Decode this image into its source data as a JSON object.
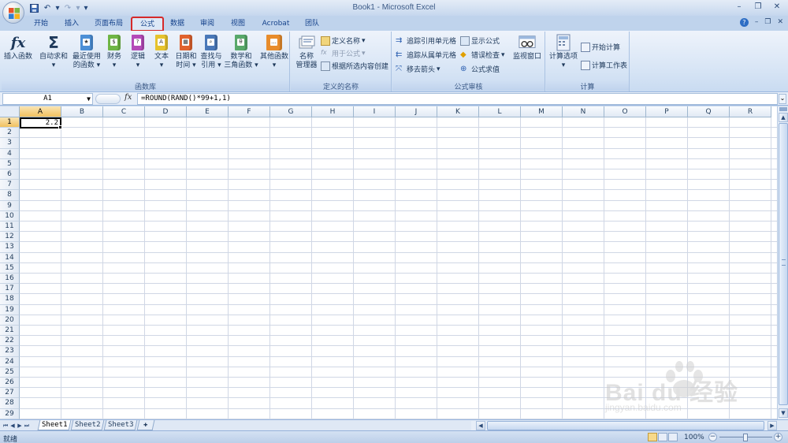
{
  "window": {
    "title": "Book1 - Microsoft Excel"
  },
  "quick_access": {
    "save_icon": "save-icon",
    "undo_icon": "undo-icon",
    "redo_icon": "redo-icon"
  },
  "tabs": [
    {
      "label": "开始"
    },
    {
      "label": "插入"
    },
    {
      "label": "页面布局"
    },
    {
      "label": "公式"
    },
    {
      "label": "数据"
    },
    {
      "label": "审阅"
    },
    {
      "label": "视图"
    },
    {
      "label": "Acrobat"
    },
    {
      "label": "团队"
    }
  ],
  "active_tab": "公式",
  "ribbon": {
    "function_library": {
      "label": "函数库",
      "insert_function": "插入函数",
      "autosum": "自动求和",
      "recent_line1": "最近使用",
      "recent_line2": "的函数",
      "financial": "财务",
      "logical": "逻辑",
      "text": "文本",
      "datetime_line1": "日期和",
      "datetime_line2": "时间",
      "lookup_line1": "查找与",
      "lookup_line2": "引用",
      "math_line1": "数学和",
      "math_line2": "三角函数",
      "more": "其他函数"
    },
    "defined_names": {
      "label": "定义的名称",
      "name_manager_line1": "名称",
      "name_manager_line2": "管理器",
      "define_name": "定义名称",
      "use_in_formula": "用于公式",
      "create_from_selection": "根据所选内容创建"
    },
    "formula_auditing": {
      "label": "公式审核",
      "trace_precedents": "追踪引用单元格",
      "trace_dependents": "追踪从属单元格",
      "remove_arrows": "移去箭头",
      "show_formulas": "显示公式",
      "error_checking": "错误检查",
      "evaluate_formula": "公式求值",
      "watch_window": "监视窗口"
    },
    "calculation": {
      "label": "计算",
      "options": "计算选项",
      "calc_now": "开始计算",
      "calc_sheet": "计算工作表"
    }
  },
  "formula_bar": {
    "name_box": "A1",
    "formula": "=ROUND(RAND()*99+1,1)"
  },
  "grid": {
    "columns": [
      "A",
      "B",
      "C",
      "D",
      "E",
      "F",
      "G",
      "H",
      "I",
      "J",
      "K",
      "L",
      "M",
      "N",
      "O",
      "P",
      "Q",
      "R"
    ],
    "rows": [
      "1",
      "2",
      "3",
      "4",
      "5",
      "6",
      "7",
      "8",
      "9",
      "10",
      "11",
      "12",
      "13",
      "14",
      "15",
      "16",
      "17",
      "18",
      "19",
      "20",
      "21",
      "22",
      "23",
      "24",
      "25",
      "26",
      "27",
      "28",
      "29"
    ],
    "active_cell_value": "2.2"
  },
  "sheets": [
    {
      "label": "Sheet1"
    },
    {
      "label": "Sheet2"
    },
    {
      "label": "Sheet3"
    }
  ],
  "status": {
    "ready": "就绪",
    "zoom": "100%"
  },
  "watermark": {
    "text": "Bai du 经验",
    "sub": "jingyan.baidu.com"
  }
}
